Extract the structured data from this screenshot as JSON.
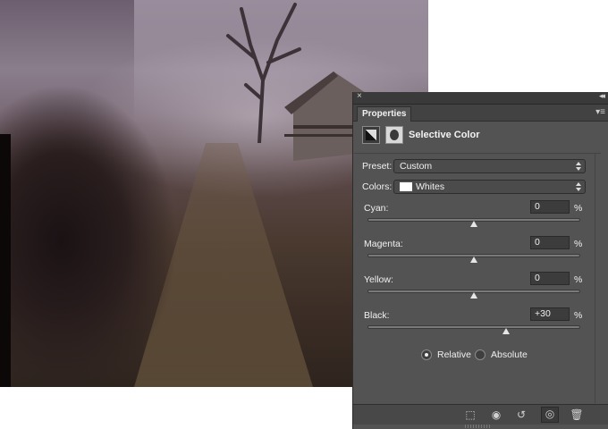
{
  "panel": {
    "close_glyph": "×",
    "collapse_glyph": "◂◂",
    "tab_label": "Properties",
    "menu_glyph": "▾≡",
    "adjustment_title": "Selective Color",
    "preset": {
      "label": "Preset:",
      "value": "Custom"
    },
    "colors": {
      "label": "Colors:",
      "value": "Whites",
      "swatch": "#ffffff"
    },
    "sliders": [
      {
        "label": "Cyan:",
        "value": "0",
        "unit": "%",
        "level": 0
      },
      {
        "label": "Magenta:",
        "value": "0",
        "unit": "%",
        "level": 0
      },
      {
        "label": "Yellow:",
        "value": "0",
        "unit": "%",
        "level": 0
      },
      {
        "label": "Black:",
        "value": "+30",
        "unit": "%",
        "level": 30
      }
    ],
    "method": {
      "options": [
        {
          "label": "Relative",
          "selected": true
        },
        {
          "label": "Absolute",
          "selected": false
        }
      ]
    },
    "bottom_icons": [
      "clip-to-layer-icon",
      "view-previous-state-icon",
      "reset-icon",
      "visibility-eye-icon",
      "trash-icon"
    ]
  },
  "colors": {
    "panel_bg": "#535353",
    "titlebar_bg": "#3a3a3a",
    "text": "#f0f0f0"
  }
}
